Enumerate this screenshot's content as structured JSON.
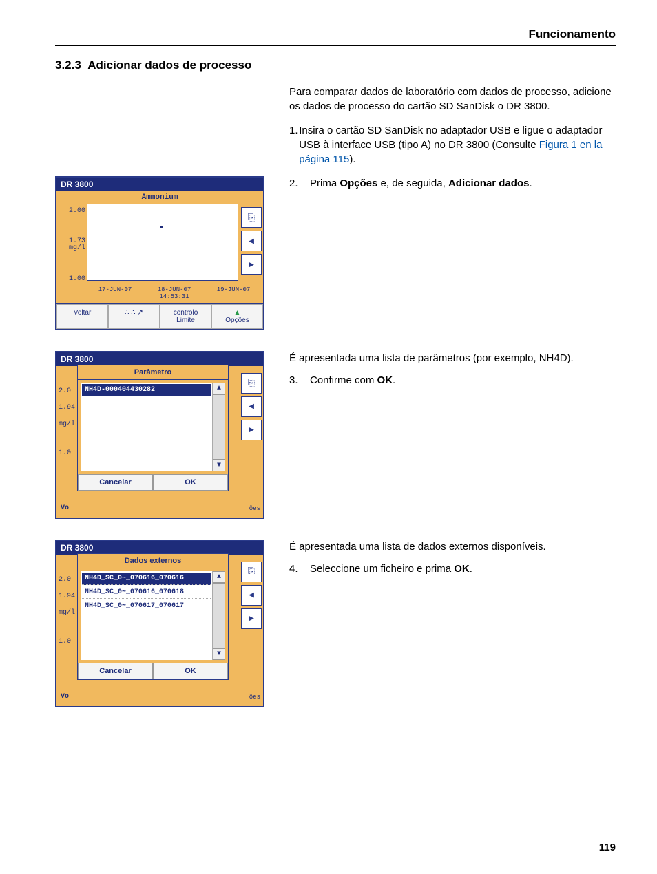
{
  "running_head": "Funcionamento",
  "section_number": "3.2.3",
  "section_title": "Adicionar dados de processo",
  "intro": "Para comparar dados de laboratório com dados de processo, adicione os dados de processo do cartão SD SanDisk o DR 3800.",
  "step1": {
    "num": "1.",
    "text_a": "Insira o cartão SD SanDisk no adaptador USB e ligue o adaptador USB à interface USB (tipo A) no DR 3800 (Consulte ",
    "link": "Figura 1 en la página 115",
    "text_b": ")."
  },
  "step2": {
    "num": "2.",
    "text_a": "Prima ",
    "bold_a": "Opções",
    "text_b": " e, de seguida, ",
    "bold_b": "Adicionar dados",
    "text_c": "."
  },
  "step3": {
    "lead": "É apresentada uma lista de parâmetros (por exemplo, NH4D).",
    "num": "3.",
    "text_a": "Confirme com ",
    "bold_a": "OK",
    "text_b": "."
  },
  "step4": {
    "lead": "É apresentada uma lista de dados externos disponíveis.",
    "num": "4.",
    "text_a": "Seleccione um ficheiro e prima ",
    "bold_a": "OK",
    "text_b": "."
  },
  "shot1": {
    "title": "DR 3800",
    "subtitle": "Ammonium",
    "ylabels": {
      "top": "2.00",
      "mid_val": "1.73",
      "mid_unit": "mg/l",
      "bottom": "1.00"
    },
    "xlabels": {
      "a": "17-JUN-07",
      "b": "18-JUN-07",
      "b2": "14:53:31",
      "c": "19-JUN-07"
    },
    "buttons": {
      "back": "Voltar",
      "limit_a": "controlo",
      "limit_b": "Limite",
      "opts": "Opções"
    }
  },
  "shot2": {
    "title": "DR 3800",
    "dialog_title": "Parâmetro",
    "item": "NH4D-000404430282",
    "cancel": "Cancelar",
    "ok": "OK",
    "voltar_stub": "Vo",
    "oes_stub": "ões",
    "y": {
      "top": "2.0",
      "mid_val": "1.94",
      "mid_unit": "mg/l",
      "bottom": "1.0"
    }
  },
  "shot3": {
    "title": "DR 3800",
    "dialog_title": "Dados externos",
    "items": [
      "NH4D_SC_0~_070616_070616",
      "NH4D_SC_0~_070616_070618",
      "NH4D_SC_0~_070617_070617"
    ],
    "cancel": "Cancelar",
    "ok": "OK",
    "voltar_stub": "Vo",
    "oes_stub": "ões",
    "y": {
      "top": "2.0",
      "mid_val": "1.94",
      "mid_unit": "mg/l",
      "bottom": "1.0"
    }
  },
  "page_number": "119",
  "chart_data": {
    "type": "scatter",
    "title": "Ammonium",
    "ylabel": "mg/l",
    "ylim": [
      1.0,
      2.0
    ],
    "x": [
      "17-JUN-07",
      "18-JUN-07",
      "19-JUN-07"
    ],
    "y": [
      1.73
    ],
    "highlight_x": "18-JUN-07 14:53:31",
    "highlight_y": 1.73
  }
}
